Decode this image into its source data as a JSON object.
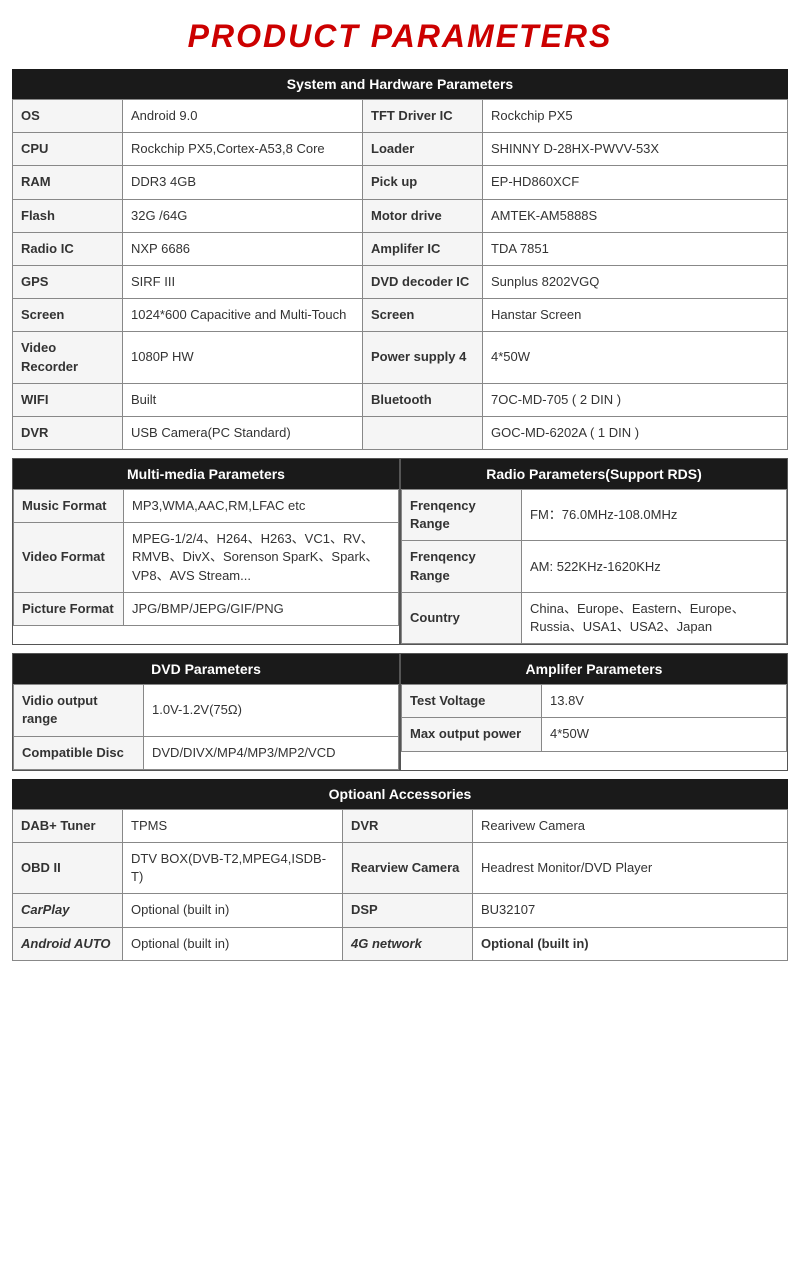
{
  "title": "PRODUCT PARAMETERS",
  "sections": {
    "system": {
      "header": "System and Hardware Parameters",
      "rows": [
        {
          "label1": "OS",
          "value1": "Android 9.0",
          "label2": "TFT Driver IC",
          "value2": "Rockchip PX5"
        },
        {
          "label1": "CPU",
          "value1": "Rockchip PX5,Cortex-A53,8 Core",
          "label2": "Loader",
          "value2": "SHINNY D-28HX-PWVV-53X"
        },
        {
          "label1": "RAM",
          "value1": "DDR3 4GB",
          "label2": "Pick up",
          "value2": "EP-HD860XCF"
        },
        {
          "label1": "Flash",
          "value1": "32G /64G",
          "label2": "Motor drive",
          "value2": "AMTEK-AM5888S"
        },
        {
          "label1": "Radio IC",
          "value1": "NXP 6686",
          "label2": "Amplifer IC",
          "value2": "TDA 7851"
        },
        {
          "label1": "GPS",
          "value1": "SIRF III",
          "label2": "DVD decoder IC",
          "value2": "Sunplus 8202VGQ"
        },
        {
          "label1": "Screen",
          "value1": "1024*600 Capacitive and Multi-Touch",
          "label2": "Screen",
          "value2": "Hanstar Screen"
        },
        {
          "label1": "Video Recorder",
          "value1": "1080P HW",
          "label2": "Power supply 4",
          "value2": "4*50W"
        },
        {
          "label1": "WIFI",
          "value1": "Built",
          "label2": "Bluetooth",
          "value2": "7OC-MD-705 ( 2 DIN )"
        },
        {
          "label1": "DVR",
          "value1": "USB Camera(PC Standard)",
          "label2": "",
          "value2": "GOC-MD-6202A ( 1 DIN )"
        }
      ]
    },
    "multimedia": {
      "header": "Multi-media Parameters",
      "rows": [
        {
          "label": "Music Format",
          "value": "MP3,WMA,AAC,RM,LFAC etc"
        },
        {
          "label": "Video Format",
          "value": "MPEG-1/2/4、H264、H263、VC1、RV、RMVB、DivX、Sorenson SparK、Spark、VP8、AVS Stream..."
        },
        {
          "label": "Picture Format",
          "value": "JPG/BMP/JEPG/GIF/PNG"
        }
      ]
    },
    "radio": {
      "header": "Radio Parameters(Support RDS)",
      "rows": [
        {
          "label": "Frenqency Range",
          "value": "FM：76.0MHz-108.0MHz"
        },
        {
          "label": "Frenqency Range",
          "value": "AM: 522KHz-1620KHz"
        },
        {
          "label": "Country",
          "value": "China、Europe、Eastern、Europe、Russia、USA1、USA2、Japan"
        }
      ]
    },
    "dvd": {
      "header": "DVD Parameters",
      "rows": [
        {
          "label": "Vidio output range",
          "value": "1.0V-1.2V(75Ω)"
        },
        {
          "label": "Compatible Disc",
          "value": "DVD/DIVX/MP4/MP3/MP2/VCD"
        }
      ]
    },
    "amplifier": {
      "header": "Amplifer Parameters",
      "rows": [
        {
          "label": "Test Voltage",
          "value": "13.8V"
        },
        {
          "label": "Max output power",
          "value": "4*50W"
        }
      ]
    },
    "accessories": {
      "header": "Optioanl Accessories",
      "rows": [
        {
          "label1": "DAB+ Tuner",
          "value1": "TPMS",
          "label2": "DVR",
          "value2": "Rearivew Camera",
          "bold1": false,
          "bold2": false
        },
        {
          "label1": "OBD II",
          "value1": "DTV BOX(DVB-T2,MPEG4,ISDB-T)",
          "label2": "Rearview Camera",
          "value2": "Headrest Monitor/DVD Player",
          "bold1": false,
          "bold2": false
        },
        {
          "label1": "CarPlay",
          "value1": "Optional (built in)",
          "label2": "DSP",
          "value2": "BU32107",
          "bold1": true,
          "bold2": false
        },
        {
          "label1": "Android AUTO",
          "value1": "Optional (built in)",
          "label2": "4G network",
          "value2": "Optional (built in)",
          "bold1": true,
          "bold2": true
        }
      ]
    }
  }
}
